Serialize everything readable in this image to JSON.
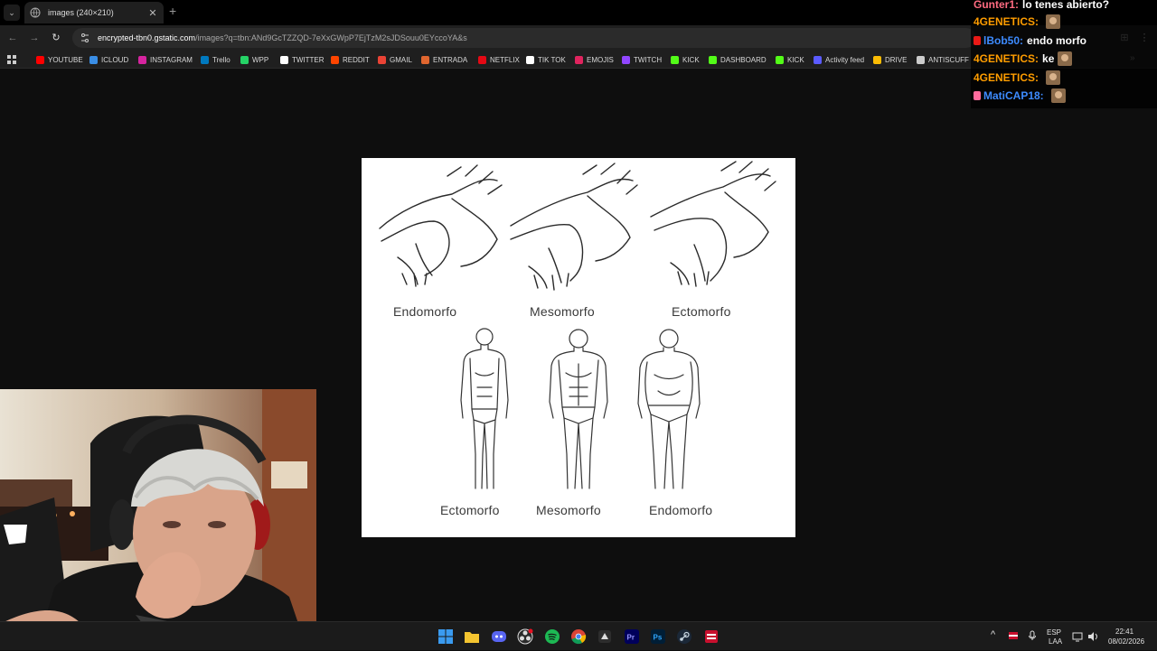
{
  "browser": {
    "tab_title": "images (240×210)",
    "new_tab_symbol": "+",
    "tab_close_symbol": "✕",
    "url_host": "encrypted-tbn0.gstatic.com",
    "url_path": "/images?q=tbn:ANd9GcTZZQD-7eXxGWpP7EjTzM2sJDSouu0EYccoYA&s",
    "bookmarks": [
      {
        "label": "YOUTUBE",
        "color": "#ff0000"
      },
      {
        "label": "ICLOUD",
        "color": "#3a8ee6"
      },
      {
        "label": "INSTAGRAM",
        "color": "#d6249f"
      },
      {
        "label": "Trello",
        "color": "#0079bf"
      },
      {
        "label": "WPP",
        "color": "#25d366"
      },
      {
        "label": "TWITTER",
        "color": "#ffffff"
      },
      {
        "label": "REDDIT",
        "color": "#ff4500"
      },
      {
        "label": "GMAIL",
        "color": "#ea4335"
      },
      {
        "label": "ENTRADA",
        "color": "#e0662f"
      },
      {
        "label": "NETFLIX",
        "color": "#e50914"
      },
      {
        "label": "TIK TOK",
        "color": "#ffffff"
      },
      {
        "label": "EMOJIS",
        "color": "#e0245e"
      },
      {
        "label": "TWITCH",
        "color": "#9146ff"
      },
      {
        "label": "KICK",
        "color": "#53fc18"
      },
      {
        "label": "DASHBOARD",
        "color": "#53fc18"
      },
      {
        "label": "KICK",
        "color": "#53fc18"
      },
      {
        "label": "Activity feed",
        "color": "#5b5bff"
      },
      {
        "label": "DRIVE",
        "color": "#fbbc04"
      },
      {
        "label": "ANTISCUFF",
        "color": "#cccccc"
      }
    ],
    "more_bookmarks_symbol": "»"
  },
  "image": {
    "labels_top": [
      "Endomorfo",
      "Mesomorfo",
      "Ectomorfo"
    ],
    "labels_bottom": [
      "Ectomorfo",
      "Mesomorfo",
      "Endomorfo"
    ]
  },
  "chat": [
    {
      "user": "Gunter1:",
      "user_color": "#ff6b81",
      "message": "lo tenes abierto?",
      "emote": false,
      "badge": ""
    },
    {
      "user": "4GENETICS:",
      "user_color": "#ff9d00",
      "message": "",
      "emote": true,
      "badge": ""
    },
    {
      "user": "lBob50:",
      "user_color": "#3d8bff",
      "message": "endo morfo",
      "emote": false,
      "badge": "#e91916"
    },
    {
      "user": "4GENETICS:",
      "user_color": "#ff9d00",
      "message": "ke",
      "emote": true,
      "badge": ""
    },
    {
      "user": "4GENETICS:",
      "user_color": "#ff9d00",
      "message": "",
      "emote": true,
      "badge": ""
    },
    {
      "user": "MatiCAP18:",
      "user_color": "#3d8bff",
      "message": "",
      "emote": true,
      "badge": "#ff6b9d"
    }
  ],
  "taskbar": {
    "lang_top": "ESP",
    "lang_bottom": "LAA",
    "time": "22:41",
    "date": "08/02/2026",
    "tray_chevron": "^"
  }
}
